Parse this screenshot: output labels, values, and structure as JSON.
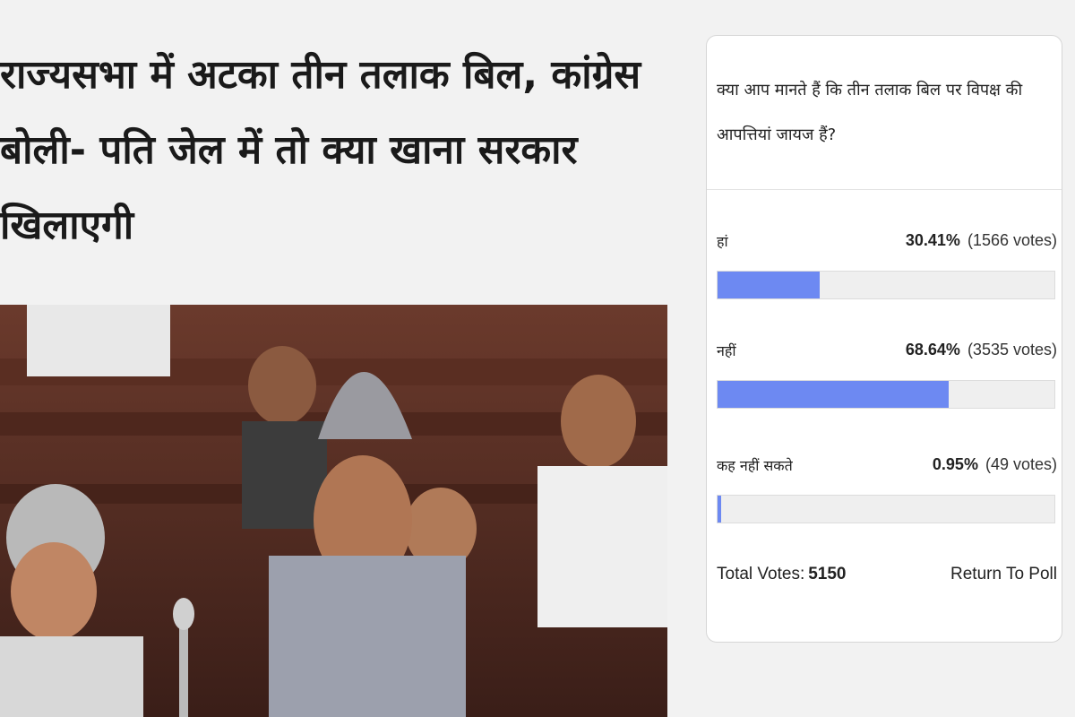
{
  "article": {
    "headline": "राज्यसभा में अटका तीन तलाक बिल, कांग्रेस बोली- पति जेल में तो क्या खाना सरकार खिलाएगी"
  },
  "poll": {
    "question": "क्या आप मानते हैं कि तीन तलाक बिल पर विपक्ष की आपत्तियां जायज हैं?",
    "options": [
      {
        "label": "हां",
        "percent": "30.41%",
        "votes": "(1566 votes)",
        "fraction": 0.3041
      },
      {
        "label": "नहीं",
        "percent": "68.64%",
        "votes": "(3535 votes)",
        "fraction": 0.6864
      },
      {
        "label": "कह नहीं सकते",
        "percent": "0.95%",
        "votes": "(49 votes)",
        "fraction": 0.0095
      }
    ],
    "total_label": "Total Votes:",
    "total_value": "5150",
    "return_label": "Return To Poll",
    "bar_color": "#6d89f2"
  }
}
